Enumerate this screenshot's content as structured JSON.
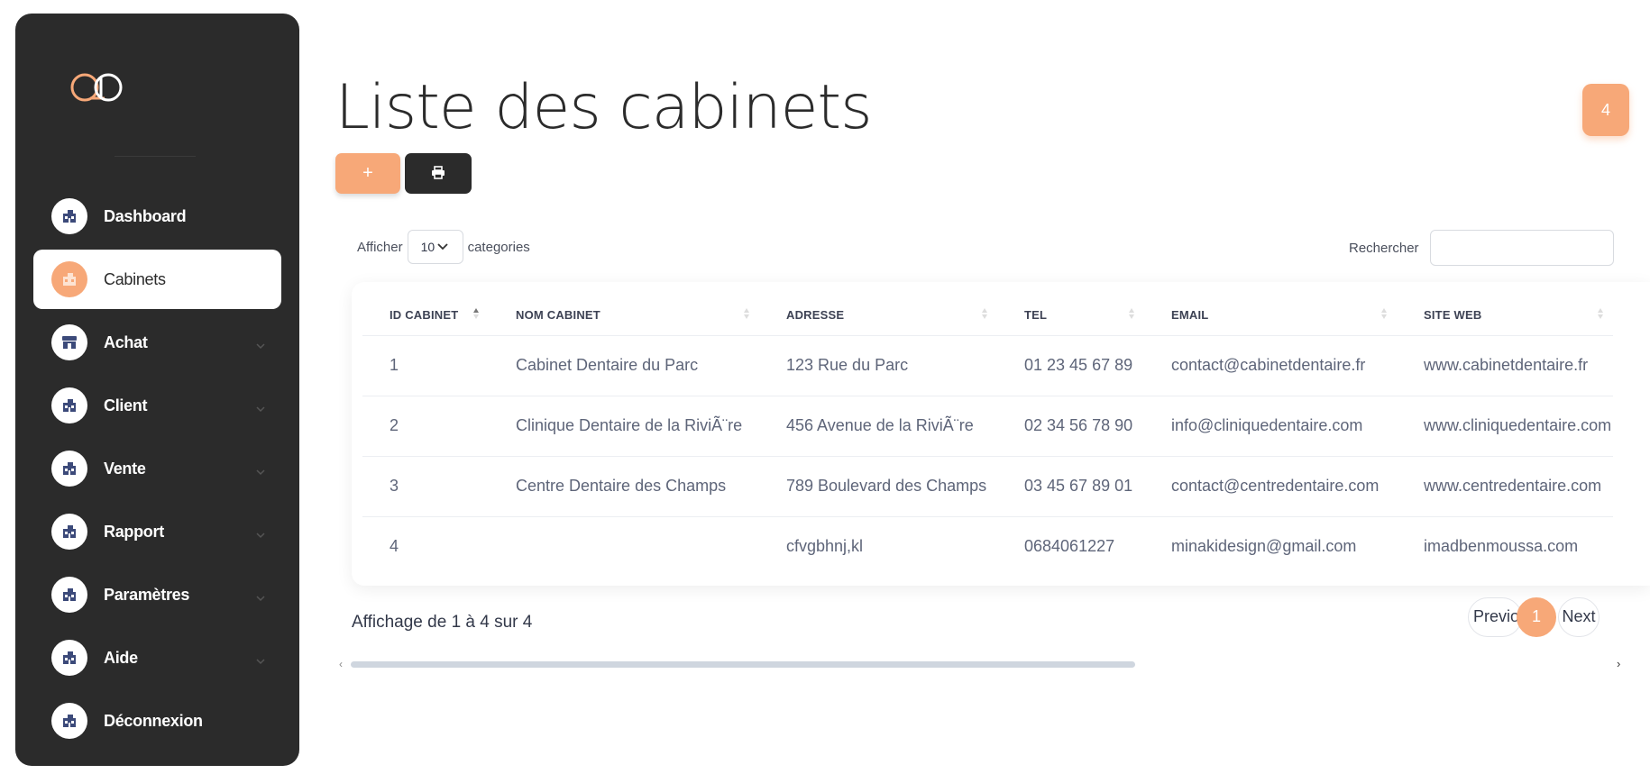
{
  "sidebar": {
    "items": [
      {
        "label": "Dashboard",
        "icon": "building-icon",
        "active": false,
        "has_chevron": false
      },
      {
        "label": "Cabinets",
        "icon": "building-icon",
        "active": true,
        "has_chevron": false
      },
      {
        "label": "Achat",
        "icon": "store-icon",
        "active": false,
        "has_chevron": true
      },
      {
        "label": "Client",
        "icon": "building-icon",
        "active": false,
        "has_chevron": true
      },
      {
        "label": "Vente",
        "icon": "building-icon",
        "active": false,
        "has_chevron": true
      },
      {
        "label": "Rapport",
        "icon": "building-icon",
        "active": false,
        "has_chevron": true
      },
      {
        "label": "Paramètres",
        "icon": "building-icon",
        "active": false,
        "has_chevron": true
      },
      {
        "label": "Aide",
        "icon": "building-icon",
        "active": false,
        "has_chevron": true
      },
      {
        "label": "Déconnexion",
        "icon": "building-icon",
        "active": false,
        "has_chevron": false
      }
    ]
  },
  "header": {
    "title": "Liste des cabinets",
    "add_label": "+",
    "badge_count": "4"
  },
  "controls": {
    "show_prefix": "Afficher",
    "show_value": "10",
    "show_suffix": "categories",
    "search_label": "Rechercher",
    "search_value": ""
  },
  "table": {
    "columns": [
      "ID CABINET",
      "NOM CABINET",
      "ADRESSE",
      "TEL",
      "EMAIL",
      "SITE WEB"
    ],
    "rows": [
      [
        "1",
        "Cabinet Dentaire du Parc",
        "123 Rue du Parc",
        "01 23 45 67 89",
        "contact@cabinetdentaire.fr",
        "www.cabinetdentaire.fr"
      ],
      [
        "2",
        "Clinique Dentaire de la RiviÃ¨re",
        "456 Avenue de la RiviÃ¨re",
        "02 34 56 78 90",
        "info@cliniquedentaire.com",
        "www.cliniquedentaire.com"
      ],
      [
        "3",
        "Centre Dentaire des Champs",
        "789 Boulevard des Champs",
        "03 45 67 89 01",
        "contact@centredentaire.com",
        "www.centredentaire.com"
      ],
      [
        "4",
        "",
        "cfvgbhnj,kl",
        "0684061227",
        "minakidesign@gmail.com",
        "imadbenmoussa.com"
      ]
    ]
  },
  "footer": {
    "info": "Affichage de 1 à 4 sur 4",
    "prev_label": "Previous",
    "current_page": "1",
    "next_label": "Next"
  },
  "colors": {
    "accent": "#f7a878",
    "sidebar_bg": "#2b2b2b"
  }
}
